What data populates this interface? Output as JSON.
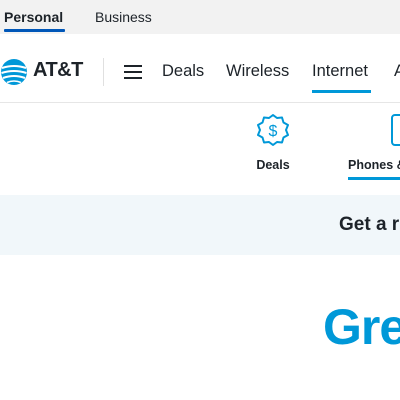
{
  "segment_tabs": {
    "personal": "Personal",
    "business": "Business"
  },
  "header": {
    "logo_text": "AT&T",
    "nav_items": [
      "Deals",
      "Wireless",
      "Internet"
    ],
    "overflow_text": "A"
  },
  "categories": {
    "deals_label": "Deals",
    "phones_label": "Phones &"
  },
  "promo": {
    "text": "Get a r"
  },
  "hero": {
    "heading": "Gre"
  },
  "colors": {
    "brand_blue": "#0098d8",
    "text": "#1d2329",
    "banner_bg": "#f1f7fa"
  },
  "icons": {
    "logo": "att-globe-icon",
    "menu": "hamburger-menu-icon",
    "deals": "dollar-badge-icon",
    "phones": "phone-icon"
  }
}
